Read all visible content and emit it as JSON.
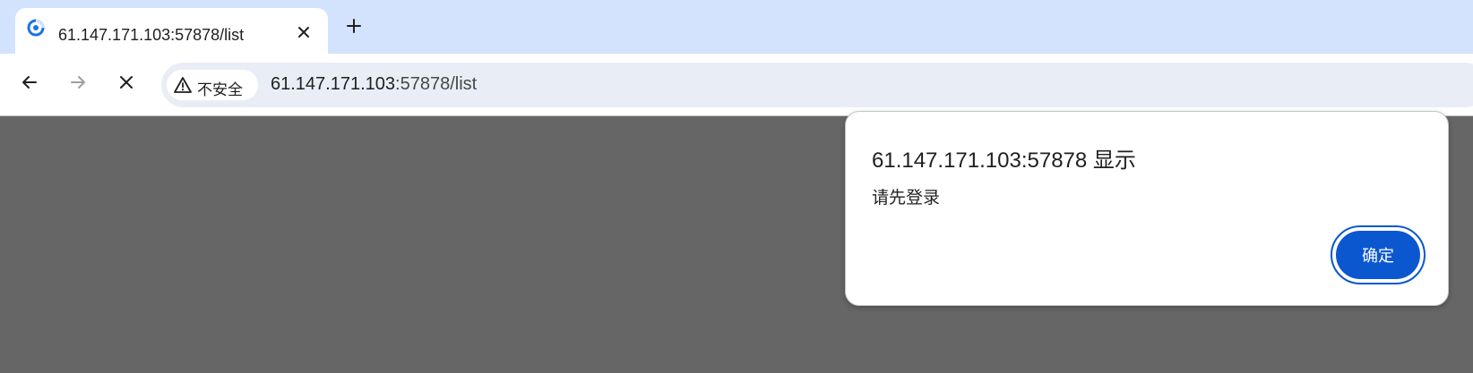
{
  "tab": {
    "title": "61.147.171.103:57878/list",
    "favicon": "loading-spinner-icon",
    "close_icon": "close-icon"
  },
  "new_tab_icon": "plus-icon",
  "toolbar": {
    "back_icon": "arrow-left-icon",
    "forward_icon": "arrow-right-icon",
    "stop_icon": "close-icon"
  },
  "omnibox": {
    "security_label": "不安全",
    "security_icon": "warning-triangle-icon",
    "url_host": "61.147.171.103",
    "url_rest": ":57878/list"
  },
  "dialog": {
    "title": "61.147.171.103:57878 显示",
    "message": "请先登录",
    "ok_label": "确定"
  },
  "colors": {
    "tabstrip": "#d3e3fd",
    "omnibox": "#e9eef6",
    "page_overlay": "#666666",
    "accent": "#0b57d0"
  }
}
